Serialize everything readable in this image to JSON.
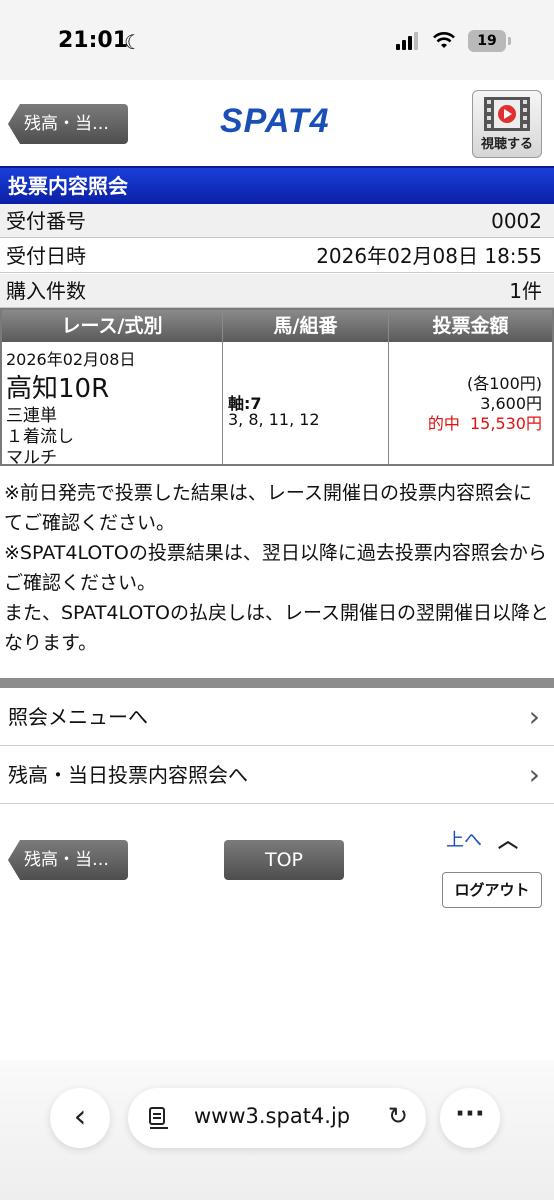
{
  "status_bar": {
    "time": "21:01",
    "battery": "19"
  },
  "header": {
    "back_label": "残高・当…",
    "logo": "SPAT4",
    "watch_label": "視聴する"
  },
  "page": {
    "title": "投票内容照会",
    "rows": [
      {
        "label": "受付番号",
        "value": "0002"
      },
      {
        "label": "受付日時",
        "value": "2026年02月08日 18:55"
      },
      {
        "label": "購入件数",
        "value": "1件"
      }
    ]
  },
  "table": {
    "headers": [
      "レース/式別",
      "馬/組番",
      "投票金額"
    ],
    "date": "2026年02月08日",
    "race": "高知10R",
    "bet_type": "三連単",
    "bet_mode": "１着流し",
    "bet_option": "マルチ",
    "axis": "軸:7",
    "combination": "3, 8, 11, 12",
    "unit_price": "(各100円)",
    "amount": "3,600円",
    "win_label": "的中",
    "win_amount": "15,530円"
  },
  "notes": [
    "※前日発売で投票した結果は、レース開催日の投票内容照会にてご確認ください。",
    "※SPAT4LOTOの投票結果は、翌日以降に過去投票内容照会からご確認ください。",
    "また、SPAT4LOTOの払戻しは、レース開催日の翌開催日以降となります。"
  ],
  "menu": {
    "inquiry_menu": "照会メニューへ",
    "balance_today": "残高・当日投票内容照会へ"
  },
  "footer": {
    "back_label": "残高・当…",
    "top_label": "TOP",
    "up_label": "上へ",
    "logout_label": "ログアウト"
  },
  "browser": {
    "url": "www3.spat4.jp"
  },
  "colors": {
    "title_bar": "#1a3fd8",
    "logo": "#1a4fb8",
    "win": "#e01010"
  }
}
